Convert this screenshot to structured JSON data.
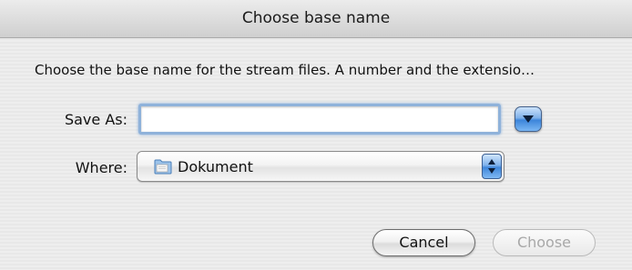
{
  "dialog": {
    "title": "Choose base name",
    "message": "Choose the base name for the stream files. A number and the extensio…"
  },
  "form": {
    "save_as_label": "Save As:",
    "save_as_value": "",
    "where_label": "Where:",
    "where_value": "Dokument"
  },
  "icons": {
    "disclosure": "chevron-down-icon",
    "folder": "folder-icon",
    "stepper": "up-down-arrows-icon"
  },
  "buttons": {
    "cancel_label": "Cancel",
    "choose_label": "Choose",
    "choose_enabled": false
  },
  "colors": {
    "accent": "#3c85da",
    "focus_ring": "#8fb2da",
    "disabled_text": "#a8a8a8"
  }
}
